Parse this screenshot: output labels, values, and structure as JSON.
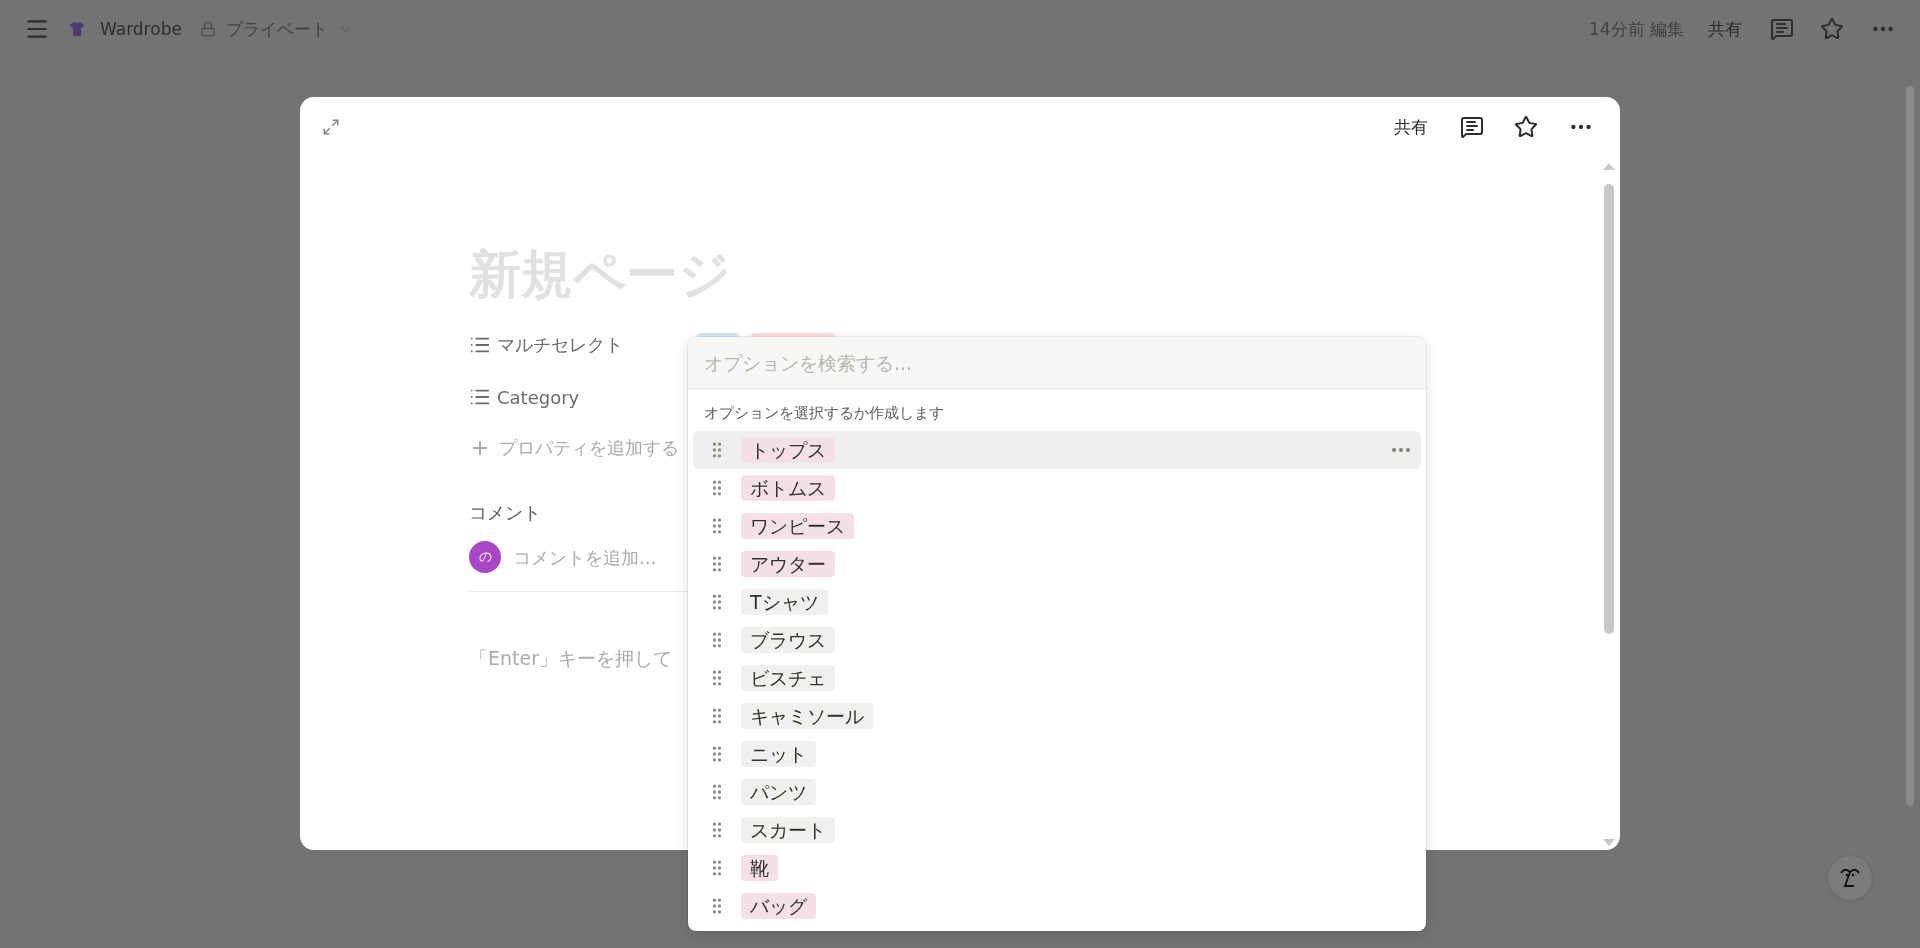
{
  "top_bar": {
    "page_title": "Wardrobe",
    "visibility": "プライベート",
    "edited": "14分前 編集",
    "share": "共有"
  },
  "modal": {
    "share": "共有",
    "title_placeholder": "新規ページ",
    "properties": [
      {
        "name": "マルチセレクト",
        "tags": [
          {
            "color": "#d3e5ef"
          },
          {
            "color": "#fadcdc"
          }
        ]
      },
      {
        "name": "Category"
      }
    ],
    "add_property": "プロパティを追加する",
    "comments_heading": "コメント",
    "comment_avatar": "の",
    "comment_placeholder": "コメントを追加...",
    "body_hint": "「Enter」キーを押して"
  },
  "dropdown": {
    "search_placeholder": "オプションを検索する...",
    "hint": "オプションを選択するか作成します",
    "options": [
      {
        "label": "トップス",
        "color": "#f5e0e9",
        "highlighted": true
      },
      {
        "label": "ボトムス",
        "color": "#f5e0e9",
        "highlighted": false
      },
      {
        "label": "ワンピース",
        "color": "#f5e0e9",
        "highlighted": false
      },
      {
        "label": "アウター",
        "color": "#f5e0e9",
        "highlighted": false
      },
      {
        "label": "Tシャツ",
        "color": "#f1f0ef",
        "highlighted": false
      },
      {
        "label": "ブラウス",
        "color": "#f1f0ef",
        "highlighted": false
      },
      {
        "label": "ビスチェ",
        "color": "#f1f0ef",
        "highlighted": false
      },
      {
        "label": "キャミソール",
        "color": "#f1f0ef",
        "highlighted": false
      },
      {
        "label": "ニット",
        "color": "#f1f0ef",
        "highlighted": false
      },
      {
        "label": "パンツ",
        "color": "#f1f0ef",
        "highlighted": false
      },
      {
        "label": "スカート",
        "color": "#f1f0ef",
        "highlighted": false
      },
      {
        "label": "靴",
        "color": "#f5e0e9",
        "highlighted": false
      },
      {
        "label": "バッグ",
        "color": "#f5e0e9",
        "highlighted": false
      }
    ]
  }
}
